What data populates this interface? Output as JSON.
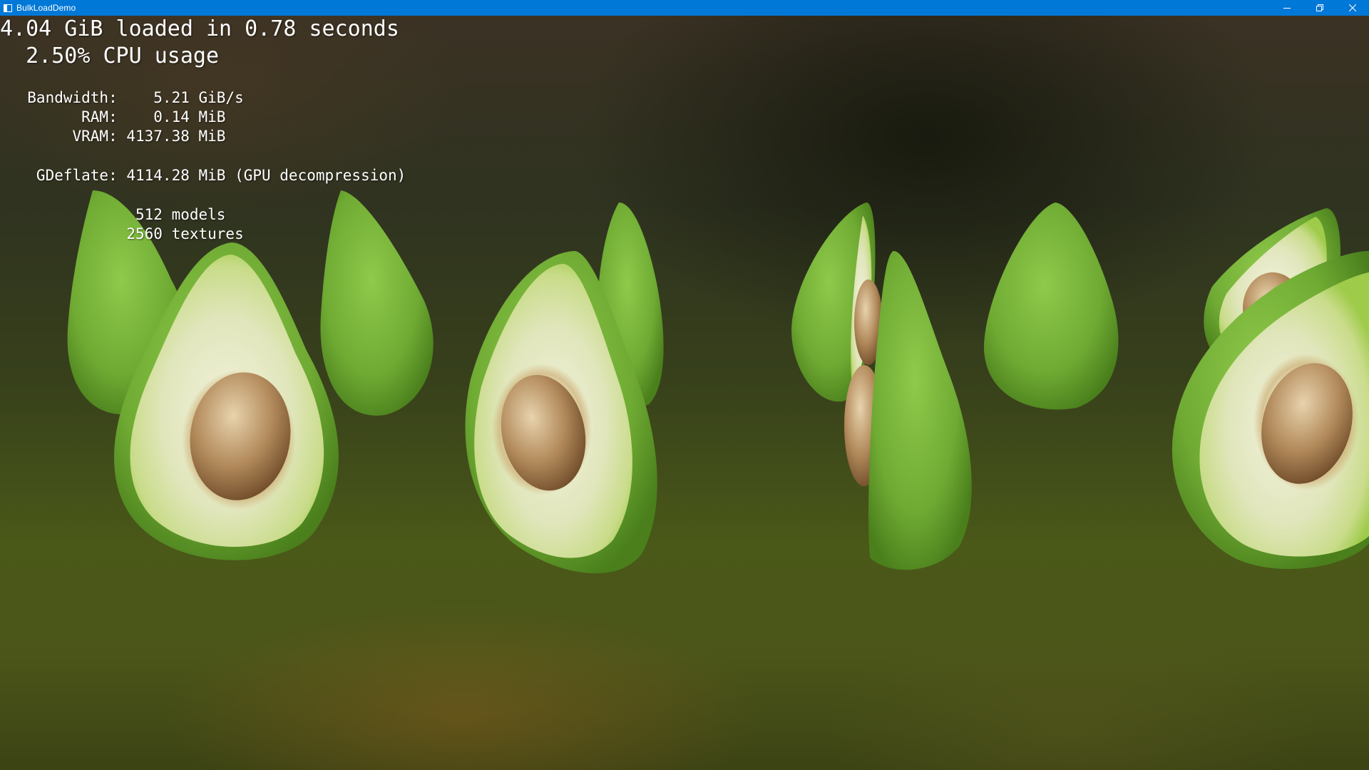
{
  "window": {
    "title": "BulkLoadDemo",
    "controls": [
      "minimize",
      "restore",
      "close"
    ],
    "titlebar_color": "#0078d7"
  },
  "stats": {
    "headline": "4.04 GiB loaded in 0.78 seconds",
    "cpu_usage": "  2.50% CPU usage",
    "bandwidth": "  Bandwidth:    5.21 GiB/s",
    "ram": "        RAM:    0.14 MiB",
    "vram": "       VRAM: 4137.38 MiB",
    "gdeflate": "   GDeflate: 4114.28 MiB (GPU decompression)",
    "models": "              512 models",
    "textures": "             2560 textures"
  },
  "scene": {
    "subject": "avocado models",
    "colors": {
      "skin": "#79b53a",
      "flesh": "#e6ebc4",
      "pit": "#a47a4d"
    }
  }
}
